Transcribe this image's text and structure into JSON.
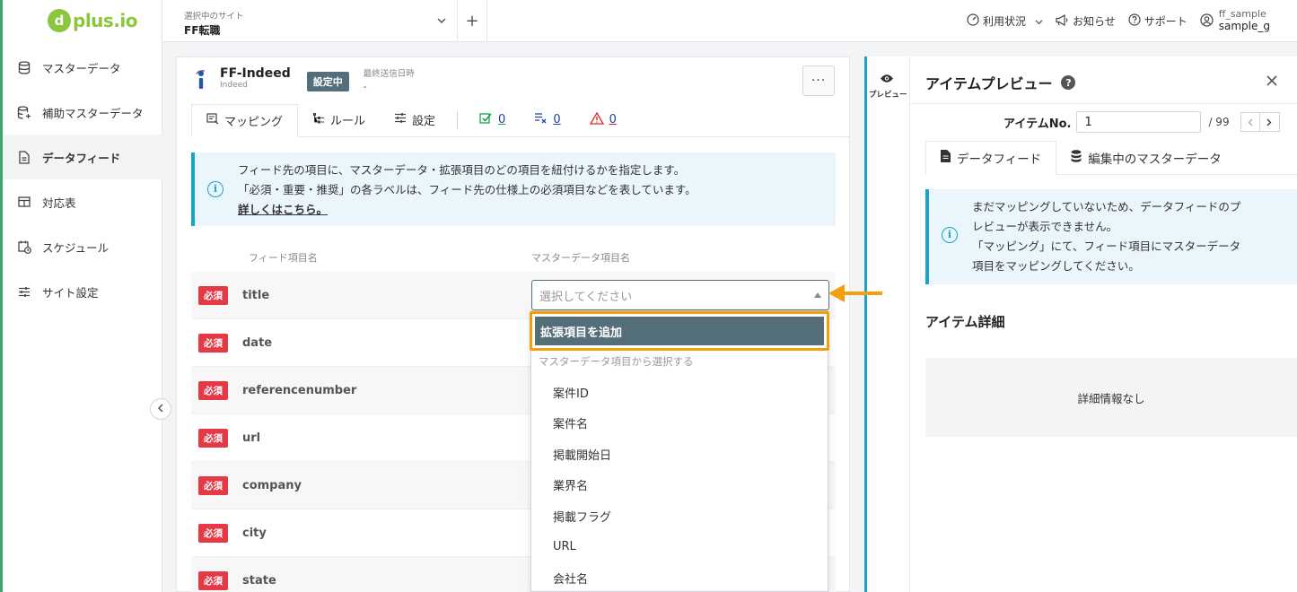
{
  "brand": {
    "logo_text": "plus.io",
    "logo_mark": "d"
  },
  "sidebar": {
    "items": [
      {
        "label": "マスターデータ",
        "icon": "database-icon"
      },
      {
        "label": "補助マスターデータ",
        "icon": "database-plus-icon"
      },
      {
        "label": "データフィード",
        "icon": "document-icon",
        "active": true
      },
      {
        "label": "対応表",
        "icon": "table-icon"
      },
      {
        "label": "スケジュール",
        "icon": "calendar-clock-icon"
      },
      {
        "label": "サイト設定",
        "icon": "sliders-icon"
      }
    ]
  },
  "header": {
    "site_label": "選択中のサイト",
    "site_name": "FF転職",
    "plus": "+",
    "usage": "利用状況",
    "notice": "お知らせ",
    "support": "サポート",
    "user_top": "ff_sample",
    "user_bottom": "sample_g"
  },
  "feed": {
    "name": "FF-Indeed",
    "sub": "Indeed",
    "status": "設定中",
    "last_sent_label": "最終送信日時",
    "last_sent_value": "-",
    "more": "···"
  },
  "tabs": {
    "mapping": "マッピング",
    "rules": "ルール",
    "settings": "設定",
    "count_ok": "0",
    "count_x": "0",
    "count_warn": "0"
  },
  "info": {
    "line1": "フィード先の項目に、マスターデータ・拡張項目のどの項目を紐付けるかを指定します。",
    "line2": "「必須・重要・推奨」の各ラベルは、フィード先の仕様上の必須項目などを表しています。",
    "link": "詳しくはこちら。"
  },
  "columns": {
    "feed_item": "フィード項目名",
    "master_item": "マスターデータ項目名"
  },
  "rows": [
    {
      "badge": "必須",
      "name": "title"
    },
    {
      "badge": "必須",
      "name": "date"
    },
    {
      "badge": "必須",
      "name": "referencenumber"
    },
    {
      "badge": "必須",
      "name": "url"
    },
    {
      "badge": "必須",
      "name": "company"
    },
    {
      "badge": "必須",
      "name": "city"
    },
    {
      "badge": "必須",
      "name": "state"
    }
  ],
  "select": {
    "placeholder": "選択してください"
  },
  "dropdown": {
    "add_label": "拡張項目を追加",
    "group_label": "マスターデータ項目から選択する",
    "options": [
      "案件ID",
      "案件名",
      "掲載開始日",
      "業界名",
      "掲載フラグ",
      "URL",
      "会社名"
    ]
  },
  "preview_toggle": {
    "label": "プレビュー"
  },
  "preview": {
    "title": "アイテムプレビュー",
    "item_no_label": "アイテムNo.",
    "item_no_value": "1",
    "item_total": "/ 99",
    "tab_feed": "データフィード",
    "tab_master": "編集中のマスターデータ",
    "info_line1": "まだマッピングしていないため、データフィードのプ",
    "info_line2": "レビューが表示できません。",
    "info_line3": "「マッピング」にて、フィード項目にマスターデータ",
    "info_line4": "項目をマッピングしてください。",
    "detail_title": "アイテム詳細",
    "detail_empty": "詳細情報なし"
  },
  "colors": {
    "accent": "#546e7a",
    "required": "#e53945",
    "highlight": "#f59e0b",
    "info": "#19a3c9",
    "brand": "#8cc63f"
  }
}
